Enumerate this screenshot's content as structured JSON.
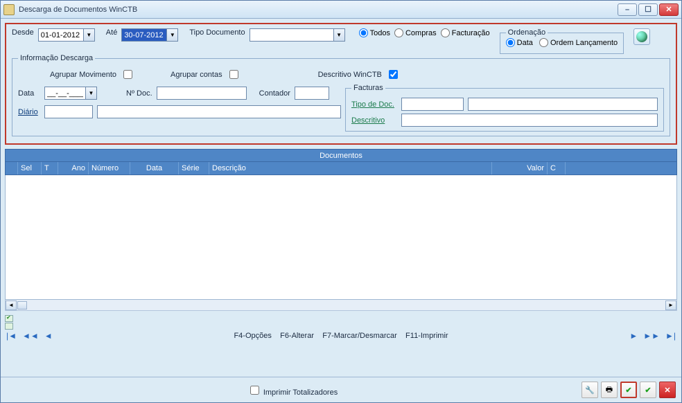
{
  "window": {
    "title": "Descarga de Documentos WinCTB"
  },
  "filter": {
    "desde_label": "Desde",
    "desde_value": "01-01-2012",
    "ate_label": "Até",
    "ate_value": "30-07-2012",
    "tipo_label": "Tipo Documento",
    "tipo_value": "",
    "radios": {
      "todos": "Todos",
      "compras": "Compras",
      "facturacao": "Facturação"
    },
    "ordenacao": {
      "legend": "Ordenação",
      "data": "Data",
      "ordem": "Ordem Lançamento"
    }
  },
  "info": {
    "legend": "Informação Descarga",
    "agrupar_mov": "Agrupar Movimento",
    "agrupar_contas": "Agrupar contas",
    "descritivo_winctb": "Descritivo WinCTB",
    "data_label": "Data",
    "data_value": "__-__-____",
    "ndoc_label": "Nº Doc.",
    "ndoc_value": "",
    "contador_label": "Contador",
    "contador_value": "",
    "diario_label": "Diário",
    "diario_value1": "",
    "diario_value2": "",
    "facturas": {
      "legend": "Facturas",
      "tipo_label": "Tipo de Doc.",
      "tipo_value1": "",
      "tipo_value2": "",
      "descritivo_label": "Descritivo",
      "descritivo_value": ""
    }
  },
  "docs": {
    "title": "Documentos",
    "columns": [
      "",
      "Sel",
      "T",
      "Ano",
      "Número",
      "Data",
      "Série",
      "Descrição",
      "Valor",
      "C"
    ]
  },
  "shortcuts": {
    "f4": "F4-Opções",
    "f6": "F6-Alterar",
    "f7": "F7-Marcar/Desmarcar",
    "f11": "F11-Imprimir"
  },
  "bottom": {
    "imprimir_total": "Imprimir Totalizadores"
  },
  "icons": {
    "minimize": "–",
    "maximize": "☐",
    "close": "✕",
    "wrench": "🔧",
    "printer": "🖶",
    "ok": "✔",
    "cancel": "✕"
  }
}
